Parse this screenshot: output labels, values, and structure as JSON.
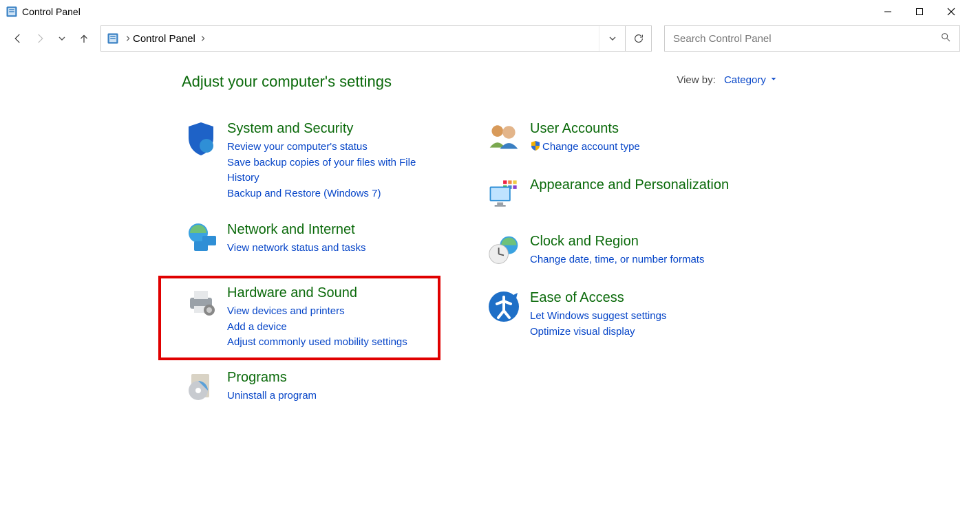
{
  "window": {
    "title": "Control Panel"
  },
  "addressbar": {
    "location": "Control Panel"
  },
  "search": {
    "placeholder": "Search Control Panel"
  },
  "heading": "Adjust your computer's settings",
  "viewby": {
    "label": "View by:",
    "value": "Category"
  },
  "categories": {
    "system_security": {
      "title": "System and Security",
      "subs": [
        "Review your computer's status",
        "Save backup copies of your files with File History",
        "Backup and Restore (Windows 7)"
      ]
    },
    "network": {
      "title": "Network and Internet",
      "subs": [
        "View network status and tasks"
      ]
    },
    "hardware": {
      "title": "Hardware and Sound",
      "subs": [
        "View devices and printers",
        "Add a device",
        "Adjust commonly used mobility settings"
      ]
    },
    "programs": {
      "title": "Programs",
      "subs": [
        "Uninstall a program"
      ]
    },
    "users": {
      "title": "User Accounts",
      "subs": [
        "Change account type"
      ]
    },
    "appearance": {
      "title": "Appearance and Personalization",
      "subs": []
    },
    "clock": {
      "title": "Clock and Region",
      "subs": [
        "Change date, time, or number formats"
      ]
    },
    "ease": {
      "title": "Ease of Access",
      "subs": [
        "Let Windows suggest settings",
        "Optimize visual display"
      ]
    }
  }
}
